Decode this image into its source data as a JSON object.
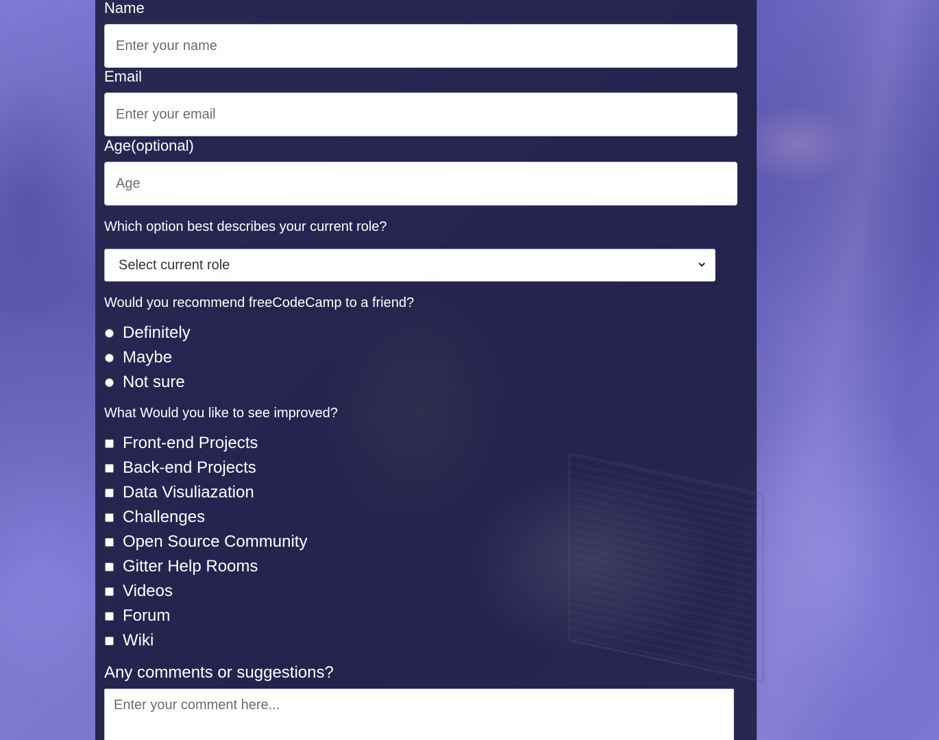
{
  "form": {
    "name": {
      "label": "Name",
      "placeholder": "Enter your name"
    },
    "email": {
      "label": "Email",
      "placeholder": "Enter your email"
    },
    "age": {
      "label": "Age(optional)",
      "placeholder": "Age"
    },
    "role": {
      "question": "Which option best describes your current role?",
      "selected": "Select current role"
    },
    "recommend": {
      "question": "Would you recommend freeCodeCamp to a friend?",
      "options": [
        "Definitely",
        "Maybe",
        "Not sure"
      ]
    },
    "improve": {
      "question": "What Would you like to see improved?",
      "options": [
        "Front-end Projects",
        "Back-end Projects",
        "Data Visuliazation",
        "Challenges",
        "Open Source Community",
        "Gitter Help Rooms",
        "Videos",
        "Forum",
        "Wiki"
      ]
    },
    "comments": {
      "label": "Any comments or suggestions?",
      "placeholder": "Enter your comment here..."
    }
  },
  "colors": {
    "panel": "#1b1b3e",
    "background": "#6f6cc4",
    "text": "#ffffff"
  }
}
